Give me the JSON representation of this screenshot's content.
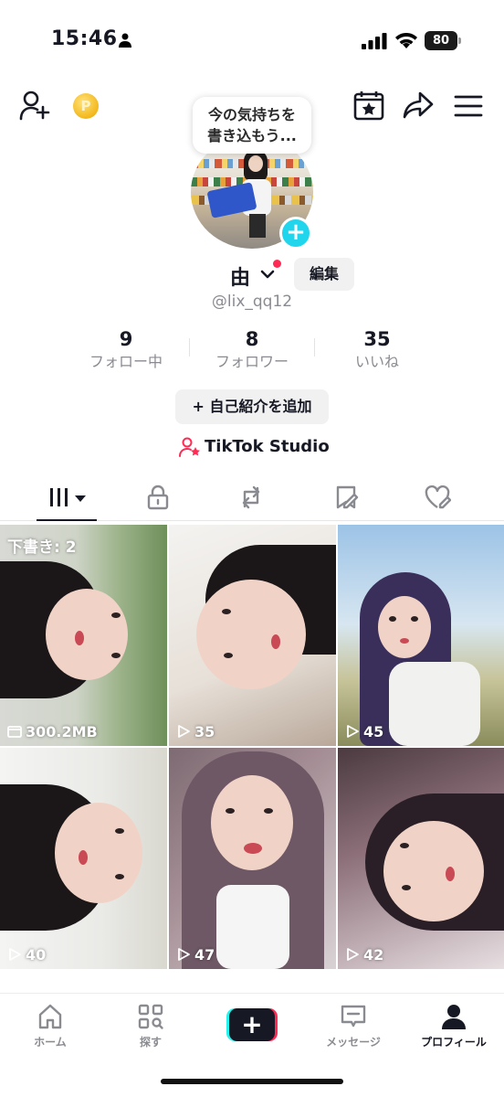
{
  "status_bar": {
    "time": "15:46",
    "battery": "80"
  },
  "profile": {
    "mood_bubble": [
      "今の気持ちを",
      "書き込もう..."
    ],
    "name": "由",
    "edit_label": "編集",
    "username": "@lix_qq12",
    "stats": [
      {
        "value": "9",
        "label": "フォロー中"
      },
      {
        "value": "8",
        "label": "フォロワー"
      },
      {
        "value": "35",
        "label": "いいね"
      }
    ],
    "add_bio_label": "+ 自己紹介を追加",
    "studio_label": "TikTok Studio"
  },
  "tabs": [
    {
      "icon": "grid-icon",
      "active": true
    },
    {
      "icon": "lock-icon"
    },
    {
      "icon": "repost-icon"
    },
    {
      "icon": "bookmark-icon"
    },
    {
      "icon": "heart-icon"
    }
  ],
  "videos": [
    {
      "draft_label": "下書き: 2",
      "size": "300.2MB"
    },
    {
      "views": "35"
    },
    {
      "views": "45"
    },
    {
      "views": "40"
    },
    {
      "views": "47"
    },
    {
      "views": "42"
    }
  ],
  "bottom_nav": [
    {
      "label": "ホーム",
      "icon": "home-icon"
    },
    {
      "label": "探す",
      "icon": "explore-icon"
    },
    {
      "label": "",
      "icon": "create-icon"
    },
    {
      "label": "メッセージ",
      "icon": "inbox-icon"
    },
    {
      "label": "プロフィール",
      "icon": "profile-icon",
      "active": true
    }
  ],
  "colors": {
    "accent": "#fe2c55",
    "cyan": "#25f4ee",
    "badge": "#20d5ec",
    "text": "#161823",
    "muted": "#8a8b91"
  }
}
